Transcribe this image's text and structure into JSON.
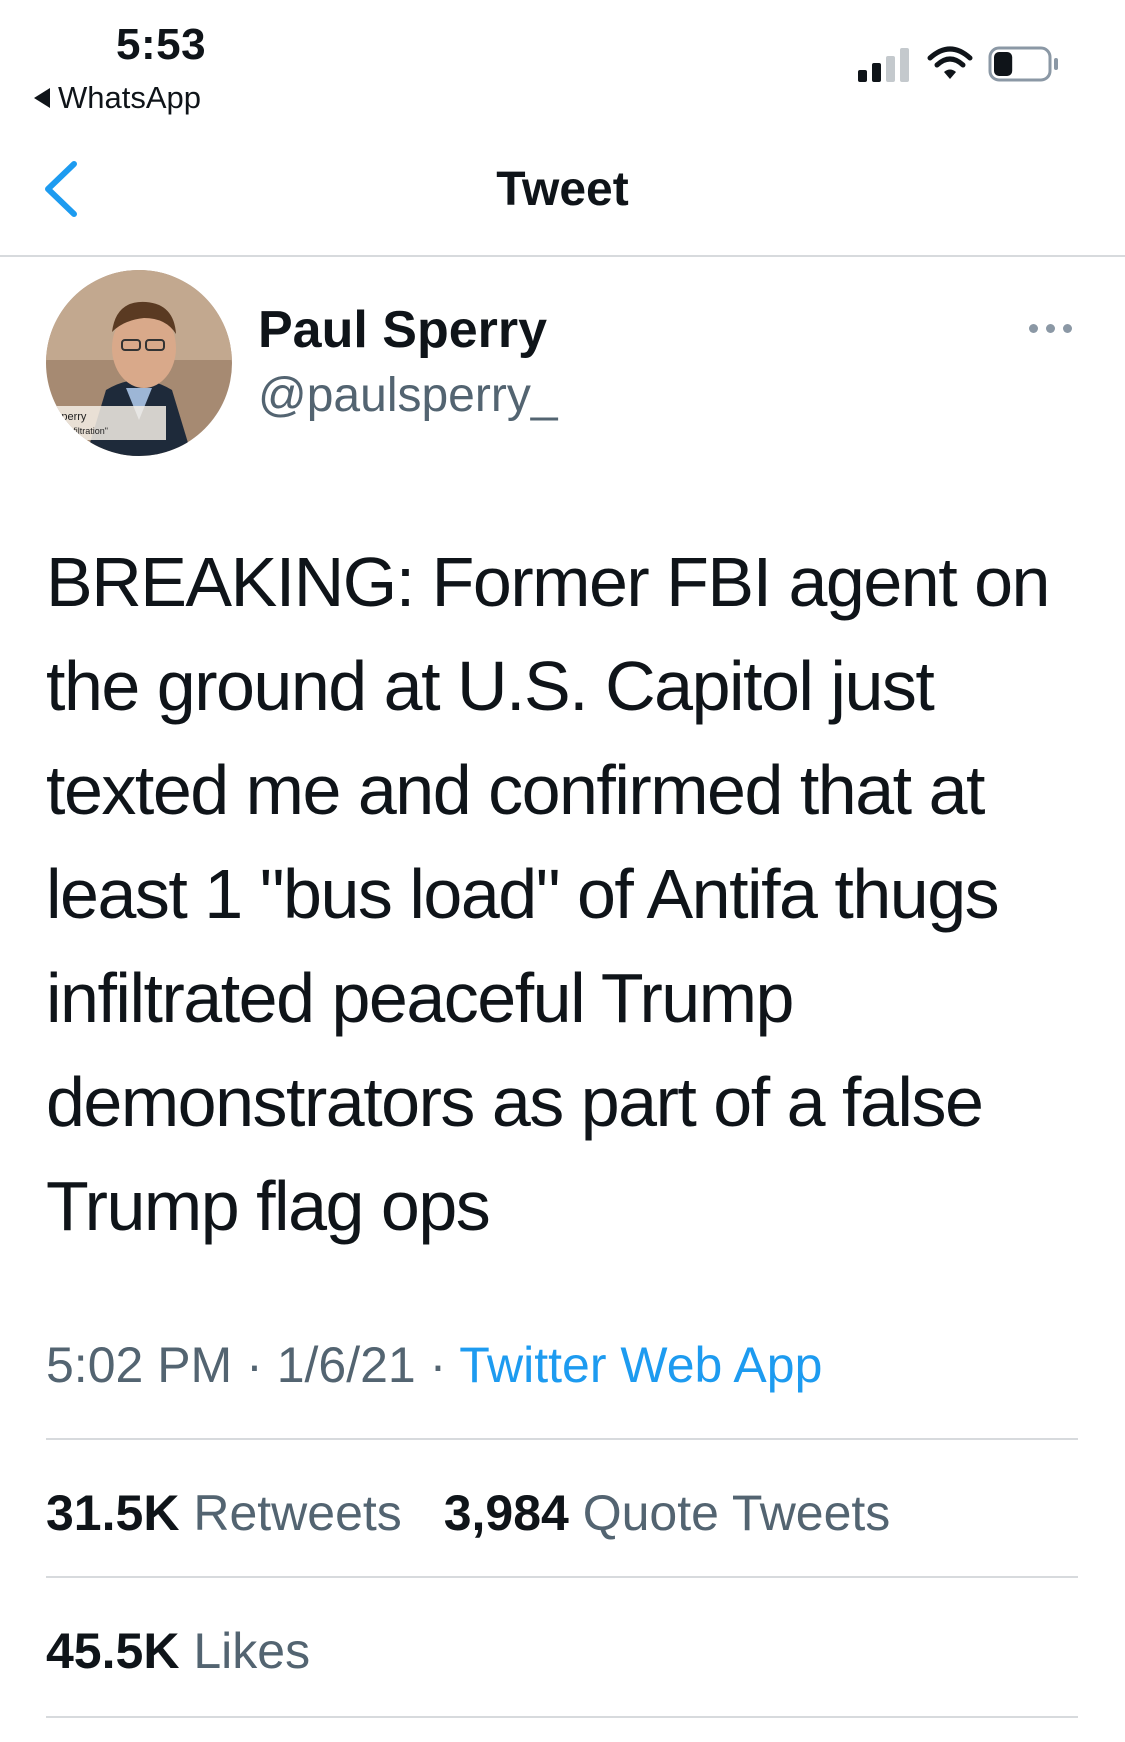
{
  "status_bar": {
    "time": "5:53",
    "back_app_label": "WhatsApp",
    "signal_bars_active": 2,
    "signal_bars_total": 4,
    "battery_level": 0.35
  },
  "nav": {
    "title": "Tweet",
    "back_icon": "chevron-left-icon"
  },
  "tweet": {
    "author_name": "Paul Sperry",
    "author_handle": "@paulsperry_",
    "avatar_caption_1": "Sperry",
    "avatar_caption_2": "or, \"Infiltration\"",
    "text": "BREAKING: Former FBI agent on the ground at U.S. Capitol just texted me and confirmed that at least 1 \"bus load\" of Antifa thugs infiltrated peaceful Trump demonstrators as part of a false Trump flag ops",
    "time": "5:02 PM",
    "sep": "·",
    "date": "1/6/21",
    "source": "Twitter Web App"
  },
  "stats": {
    "retweets_count": "31.5K",
    "retweets_label": "Retweets",
    "quotes_count": "3,984",
    "quotes_label": "Quote Tweets",
    "likes_count": "45.5K",
    "likes_label": "Likes"
  },
  "colors": {
    "link": "#1d9bf0",
    "secondary_text": "#536471",
    "divider": "#d7dadd"
  }
}
